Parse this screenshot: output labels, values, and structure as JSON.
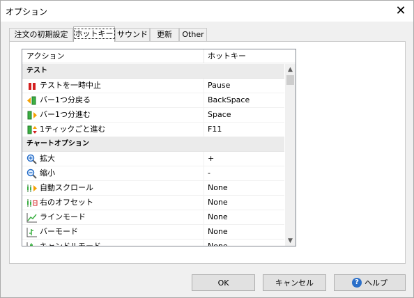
{
  "window": {
    "title": "オプション",
    "close_label": "✕"
  },
  "tabs": [
    {
      "label": "注文の初期設定"
    },
    {
      "label": "ホットキー"
    },
    {
      "label": "サウンド"
    },
    {
      "label": "更新"
    },
    {
      "label": "Other"
    }
  ],
  "hotkeys": {
    "columns": {
      "action": "アクション",
      "hotkey": "ホットキー"
    },
    "groups": [
      {
        "label": "テスト",
        "items": [
          {
            "action": "テストを一時中止",
            "key": "Pause",
            "icon": "pause-icon"
          },
          {
            "action": "バー1つ分戻る",
            "key": "BackSpace",
            "icon": "step-back-icon"
          },
          {
            "action": "バー1つ分進む",
            "key": "Space",
            "icon": "step-forward-icon"
          },
          {
            "action": "1ティックごと進む",
            "key": "F11",
            "icon": "tick-step-icon"
          }
        ]
      },
      {
        "label": "チャートオプション",
        "items": [
          {
            "action": "拡大",
            "key": "+",
            "icon": "zoom-in-icon"
          },
          {
            "action": "縮小",
            "key": "-",
            "icon": "zoom-out-icon"
          },
          {
            "action": "自動スクロール",
            "key": "None",
            "icon": "auto-scroll-icon"
          },
          {
            "action": "右のオフセット",
            "key": "None",
            "icon": "right-offset-icon"
          },
          {
            "action": "ラインモード",
            "key": "None",
            "icon": "line-mode-icon"
          },
          {
            "action": "バーモード",
            "key": "None",
            "icon": "bar-mode-icon"
          },
          {
            "action": "キャンドルモード",
            "key": "None",
            "icon": "candle-mode-icon"
          }
        ]
      }
    ]
  },
  "buttons": {
    "ok": "OK",
    "cancel": "キャンセル",
    "help": "ヘルプ",
    "help_icon": "?"
  }
}
